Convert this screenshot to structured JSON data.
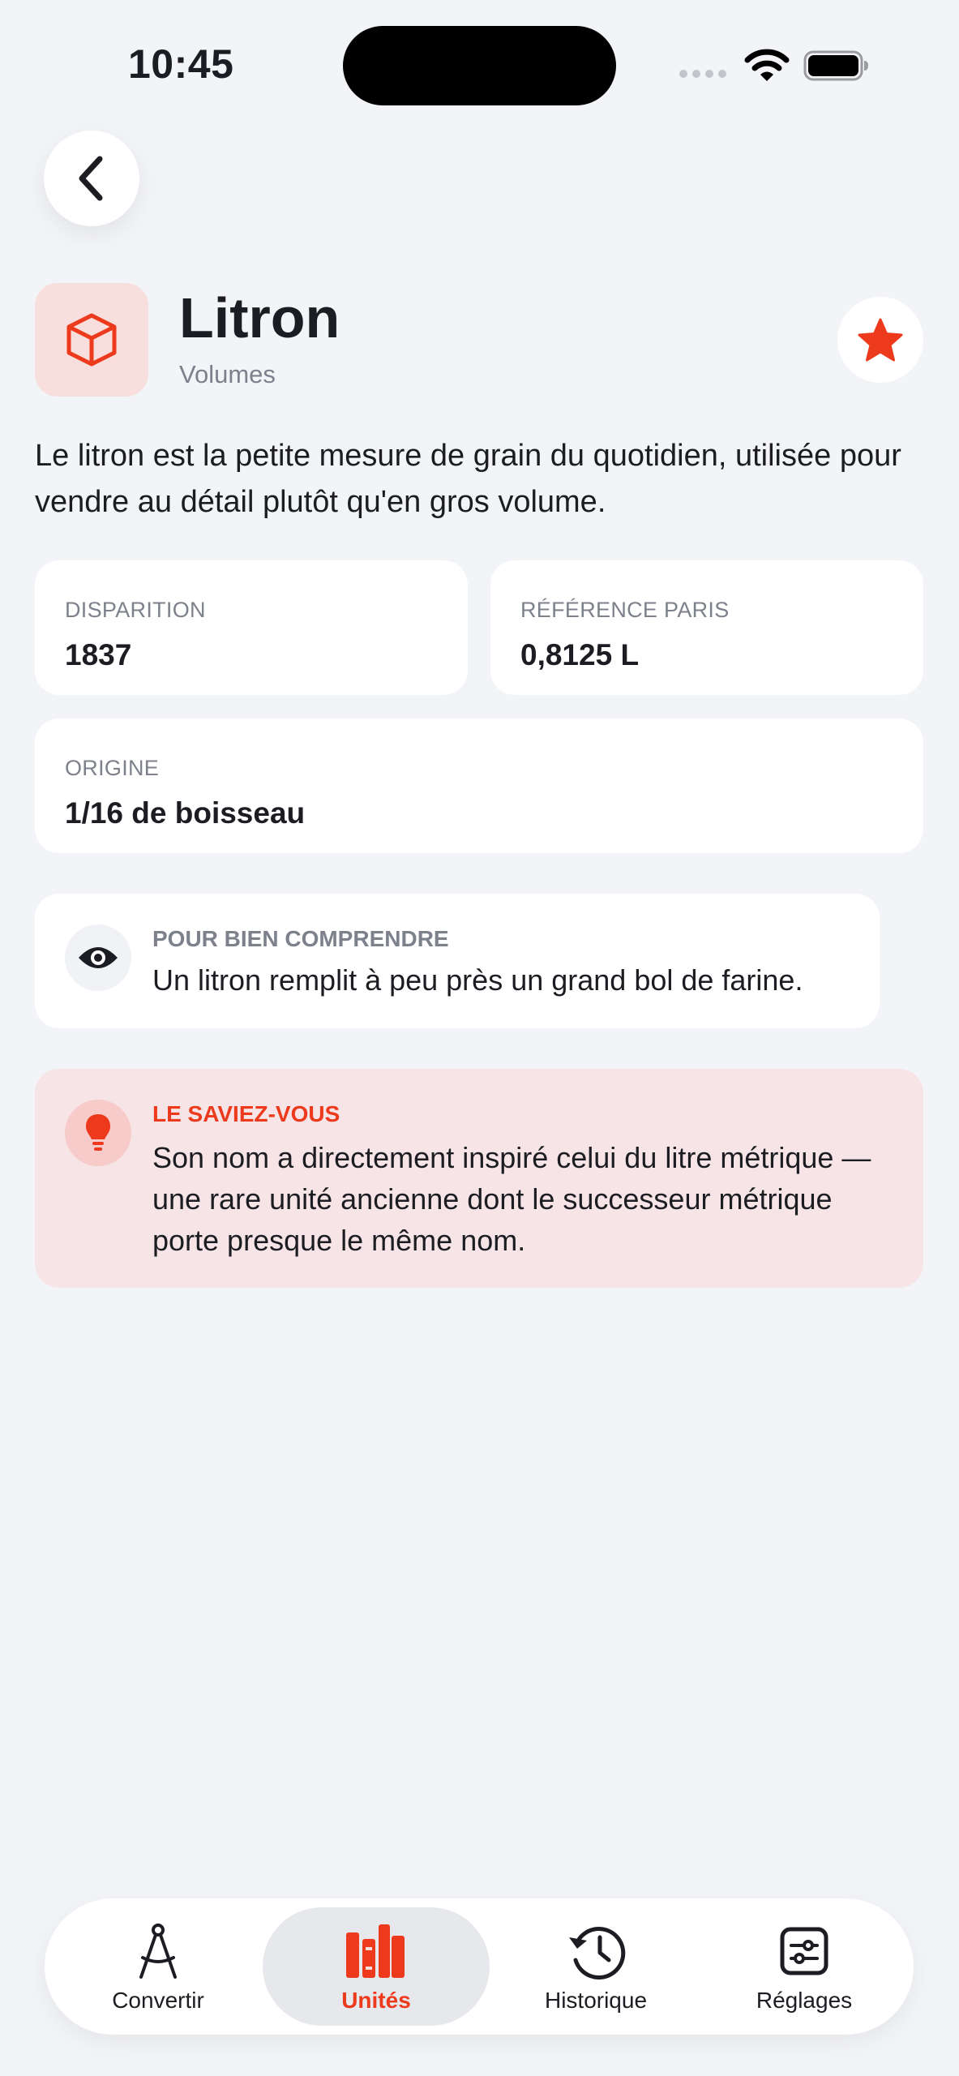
{
  "status_bar": {
    "time": "10:45"
  },
  "header": {
    "title": "Litron",
    "category": "Volumes"
  },
  "description": "Le litron est la petite mesure de grain du quotidien, utilisée pour vendre au détail plutôt qu'en gros volume.",
  "stats": {
    "disparition": {
      "label": "DISPARITION",
      "value": "1837"
    },
    "reference": {
      "label": "RÉFÉRENCE PARIS",
      "value": "0,8125 L"
    },
    "origine": {
      "label": "ORIGINE",
      "value": "1/16 de boisseau"
    }
  },
  "understand": {
    "label": "POUR BIEN COMPRENDRE",
    "text": "Un litron remplit à peu près un grand bol de farine."
  },
  "fact": {
    "label": "LE SAVIEZ-VOUS",
    "text": "Son nom a directement inspiré celui du litre métrique — une rare unité ancienne dont le successeur métrique porte presque le même nom."
  },
  "tabs": [
    {
      "label": "Convertir",
      "icon": "compass-icon",
      "active": false
    },
    {
      "label": "Unités",
      "icon": "books-icon",
      "active": true
    },
    {
      "label": "Historique",
      "icon": "history-icon",
      "active": false
    },
    {
      "label": "Réglages",
      "icon": "sliders-icon",
      "active": false
    }
  ],
  "colors": {
    "accent": "#ee3a1c",
    "background": "#f3f4f8",
    "fact_background": "#f6e4e6",
    "icon_tile": "#f8dedd"
  },
  "icons": {
    "unit": "cube-icon",
    "favorite": "star-icon",
    "back": "chevron-left-icon",
    "understand": "eye-icon",
    "fact": "lightbulb-icon"
  }
}
